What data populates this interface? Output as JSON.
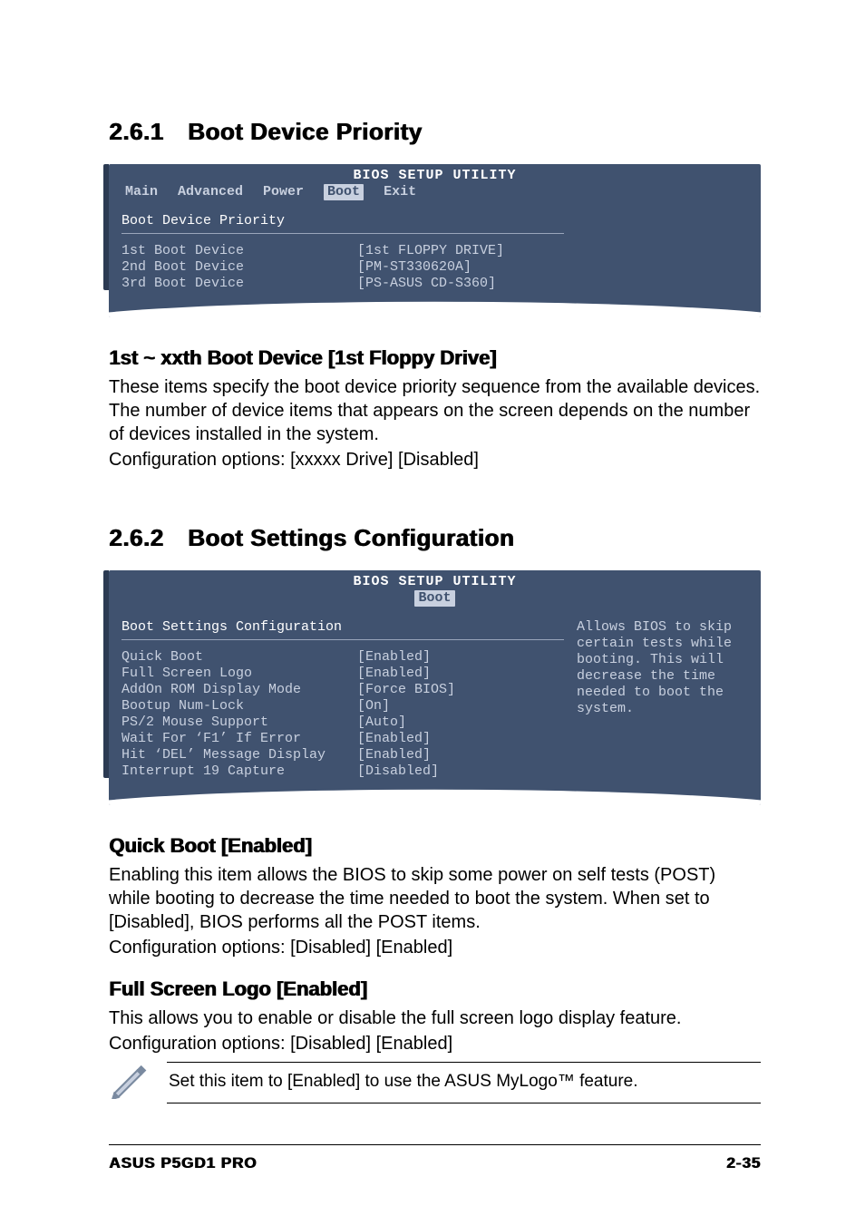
{
  "section1": {
    "heading": "2.6.1 Boot Device Priority",
    "bios": {
      "title": "BIOS SETUP UTILITY",
      "tabs": [
        "Main",
        "Advanced",
        "Power",
        "Boot",
        "Exit"
      ],
      "active_tab": "Boot",
      "panel_title": "Boot Device Priority",
      "rows": [
        {
          "k": "1st Boot Device",
          "v": "[1st FLOPPY DRIVE]"
        },
        {
          "k": "2nd Boot Device",
          "v": "[PM-ST330620A]"
        },
        {
          "k": "3rd Boot Device",
          "v": "[PS-ASUS CD-S360]"
        }
      ]
    },
    "sub_heading": "1st ~ xxth Boot Device [1st Floppy Drive]",
    "body1": "These items specify the boot device priority sequence from the available devices. The number of device items that appears on the screen depends on the number of devices installed in the system.",
    "body2": "Configuration options: [xxxxx Drive] [Disabled]"
  },
  "section2": {
    "heading": "2.6.2 Boot Settings Configuration",
    "bios": {
      "title": "BIOS SETUP UTILITY",
      "active_tab": "Boot",
      "panel_title": "Boot Settings Configuration",
      "rows": [
        {
          "k": "Quick Boot",
          "v": "[Enabled]"
        },
        {
          "k": "Full Screen Logo",
          "v": "[Enabled]"
        },
        {
          "k": "AddOn ROM Display Mode",
          "v": "[Force BIOS]"
        },
        {
          "k": "Bootup Num-Lock",
          "v": "[On]"
        },
        {
          "k": "PS/2 Mouse Support",
          "v": "[Auto]"
        },
        {
          "k": "Wait For ‘F1’ If Error",
          "v": "[Enabled]"
        },
        {
          "k": "Hit ‘DEL’ Message Display",
          "v": "[Enabled]"
        },
        {
          "k": "Interrupt 19 Capture",
          "v": "[Disabled]"
        }
      ],
      "help": "Allows BIOS to skip certain tests while booting. This will decrease the time needed to boot the system."
    },
    "quick_boot": {
      "heading": "Quick Boot [Enabled]",
      "body1": "Enabling this item allows the BIOS to skip some power on self tests (POST) while booting to decrease the time needed to boot the system. When set to [Disabled], BIOS performs all the POST items.",
      "body2": "Configuration options: [Disabled] [Enabled]"
    },
    "full_screen_logo": {
      "heading": "Full Screen Logo [Enabled]",
      "body1": "This allows you to enable or disable the full screen logo display feature.",
      "body2": "Configuration options: [Disabled] [Enabled]"
    },
    "note": "Set this item to [Enabled] to use the ASUS MyLogo™ feature."
  },
  "footer": {
    "left": "ASUS P5GD1 PRO",
    "right": "2-35"
  }
}
